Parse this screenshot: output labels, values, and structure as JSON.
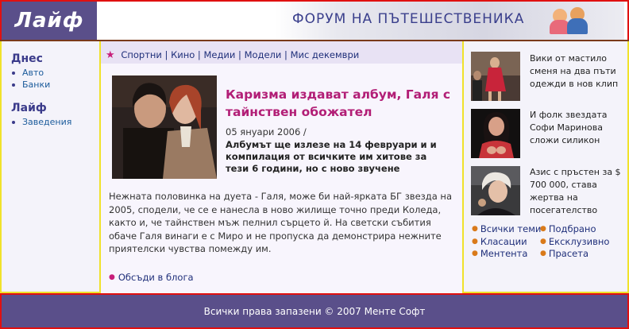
{
  "header": {
    "logo": "Лайф",
    "banner_text": "Форум на пътешественика",
    "banner_icon": "people-icon"
  },
  "sidebar": {
    "sections": [
      {
        "title": "Днес",
        "items": [
          "Авто",
          "Банки"
        ]
      },
      {
        "title": "Лайф",
        "items": [
          "Заведения"
        ]
      }
    ]
  },
  "subnav": {
    "icon": "star-icon",
    "links": [
      "Спортни",
      "Кино",
      "Медии",
      "Модели",
      "Мис декември"
    ],
    "separator": " | "
  },
  "article": {
    "title": "Каризма издават албум, Галя с тайнствен обожател",
    "date": "05 януари 2006 /",
    "lead": "Албумът ще излезе на 14 февруари и и компилация от всичките им хитове за тези 6 години, но с ново звучене",
    "body": "Нежната половинка на дуета - Галя, може би най-ярката БГ звезда на 2005, сподели, че се е нанесла в ново жилище точно преди Коледа, както и, че тайнствен мъж пелнил сърцето й. На светски събития обаче Галя винаги е с Миро и не пропуска да демонстрира нежните приятелски чувства помежду им.",
    "blog_link": "Обсъди в блога"
  },
  "right_news": [
    {
      "text": "Вики от мастило сменя на два пъти одежди в нов клип"
    },
    {
      "text": "И фолк звездата Софи Маринова сложи силикон"
    },
    {
      "text": "Азис с пръстен за $ 700 000, става жертва на посегателство"
    }
  ],
  "right_links": [
    "Всички теми",
    "Подбрано",
    "Класации",
    "Ексклузивно",
    "Ментента",
    "Прасета"
  ],
  "footer": {
    "text": "Всички права запазени © 2007 Менте Софт"
  },
  "colors": {
    "header_purple": "#5a4f8a",
    "title_magenta": "#b21e76",
    "border_red": "#e01010",
    "border_yellow": "#f0e22a"
  }
}
